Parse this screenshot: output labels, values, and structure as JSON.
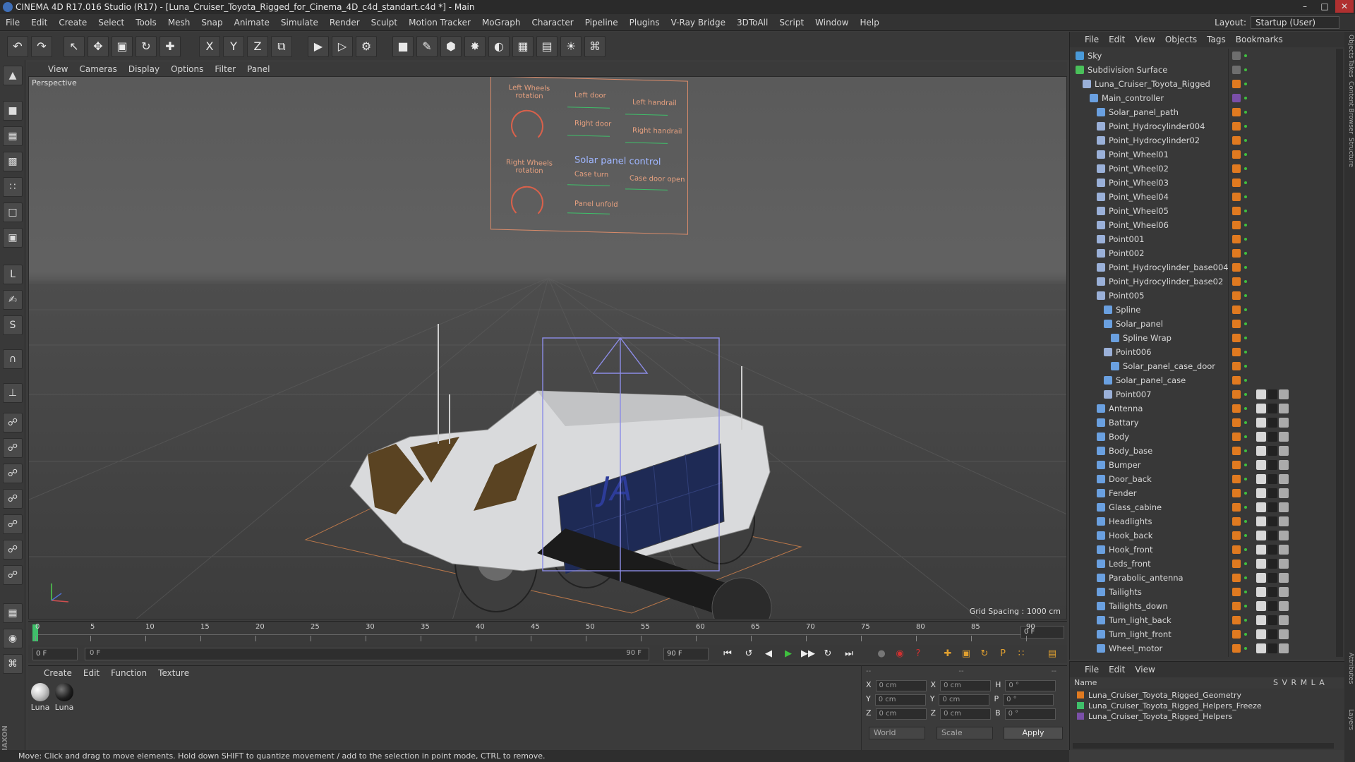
{
  "window": {
    "title": "CINEMA 4D R17.016 Studio (R17) - [Luna_Cruiser_Toyota_Rigged_for_Cinema_4D_c4d_standart.c4d *] - Main",
    "controls": [
      "–",
      "□",
      "✕"
    ]
  },
  "menubar": {
    "items": [
      "File",
      "Edit",
      "Create",
      "Select",
      "Tools",
      "Mesh",
      "Snap",
      "Animate",
      "Simulate",
      "Render",
      "Sculpt",
      "Motion Tracker",
      "MoGraph",
      "Character",
      "Pipeline",
      "Plugins",
      "V-Ray Bridge",
      "3DToAll",
      "Script",
      "Window",
      "Help"
    ],
    "layout_label": "Layout:",
    "layout_value": "Startup (User)"
  },
  "toolbar": {
    "buttons": [
      {
        "name": "undo",
        "glyph": "↶"
      },
      {
        "name": "redo",
        "glyph": "↷"
      },
      {
        "name": "live-selection",
        "glyph": "↖"
      },
      {
        "name": "move",
        "glyph": "✥"
      },
      {
        "name": "scale",
        "glyph": "▣"
      },
      {
        "name": "rotate",
        "glyph": "↻"
      },
      {
        "name": "last-tool",
        "glyph": "✚"
      },
      {
        "name": "x-axis",
        "glyph": "X"
      },
      {
        "name": "y-axis",
        "glyph": "Y"
      },
      {
        "name": "z-axis",
        "glyph": "Z"
      },
      {
        "name": "coordinate-system",
        "glyph": "⧉"
      },
      {
        "name": "render-view",
        "glyph": "▶"
      },
      {
        "name": "render-picture-viewer",
        "glyph": "▷"
      },
      {
        "name": "edit-render-settings",
        "glyph": "⚙"
      },
      {
        "name": "cube",
        "glyph": "■"
      },
      {
        "name": "spline-pen",
        "glyph": "✎"
      },
      {
        "name": "subdivision-surface",
        "glyph": "⬢"
      },
      {
        "name": "array",
        "glyph": "✸"
      },
      {
        "name": "deformer",
        "glyph": "◐"
      },
      {
        "name": "floor",
        "glyph": "▦"
      },
      {
        "name": "camera",
        "glyph": "▤"
      },
      {
        "name": "light",
        "glyph": "☀"
      },
      {
        "name": "python",
        "glyph": "⌘"
      }
    ]
  },
  "viewport": {
    "menu": [
      "View",
      "Cameras",
      "Display",
      "Options",
      "Filter",
      "Panel"
    ],
    "label": "Perspective",
    "grid_spacing": "Grid Spacing : 1000 cm",
    "control_board": {
      "left_wheels": "Left Wheels rotation",
      "right_wheels": "Right Wheels rotation",
      "left_door": "Left door",
      "right_door": "Right door",
      "left_handrail": "Left handrail",
      "right_handrail": "Right handrail",
      "solar_title": "Solar panel control",
      "case_turn": "Case turn",
      "case_door": "Case door open",
      "panel_unfold": "Panel unfold"
    }
  },
  "timeline": {
    "ticks": [
      "0",
      "5",
      "10",
      "15",
      "20",
      "25",
      "30",
      "35",
      "40",
      "45",
      "50",
      "55",
      "60",
      "65",
      "70",
      "75",
      "80",
      "85",
      "90"
    ],
    "frame_field": "0 F"
  },
  "transport": {
    "start_field": "0 F",
    "range_left": "0 F",
    "range_right": "90 F",
    "end_field": "90 F",
    "buttons": [
      "⏮",
      "↺",
      "◀",
      "▶",
      "▶▶",
      "↻",
      "⏭"
    ]
  },
  "material_panel": {
    "menu": [
      "Create",
      "Edit",
      "Function",
      "Texture"
    ],
    "materials": [
      {
        "label": "Luna",
        "color": "#c8c8c8"
      },
      {
        "label": "Luna",
        "color": "#1e1e1e"
      }
    ]
  },
  "coord_panel": {
    "header": [
      "--",
      "--",
      "--"
    ],
    "rows": [
      {
        "a": "X",
        "av": "0 cm",
        "b": "X",
        "bv": "0 cm",
        "c": "H",
        "cv": "0 °"
      },
      {
        "a": "Y",
        "av": "0 cm",
        "b": "Y",
        "bv": "0 cm",
        "c": "P",
        "cv": "0 °"
      },
      {
        "a": "Z",
        "av": "0 cm",
        "b": "Z",
        "bv": "0 cm",
        "c": "B",
        "cv": "0 °"
      }
    ],
    "world": "World",
    "scale": "Scale",
    "apply": "Apply"
  },
  "status": "Move: Click and drag to move elements. Hold down SHIFT to quantize movement / add to the selection in point mode, CTRL to remove.",
  "object_manager": {
    "menu": [
      "File",
      "Edit",
      "View",
      "Objects",
      "Tags",
      "Bookmarks"
    ],
    "objects": [
      {
        "name": "Sky",
        "depth": 0,
        "icon": "#4a9ad9",
        "sw": "#6e6e6e"
      },
      {
        "name": "Subdivision Surface",
        "depth": 0,
        "icon": "#4ac05a",
        "sw": "#6e6e6e"
      },
      {
        "name": "Luna_Cruiser_Toyota_Rigged",
        "depth": 1,
        "icon": "#9ab0d8",
        "sw": "#e07a20"
      },
      {
        "name": "Main_controller",
        "depth": 2,
        "icon": "#6aa0e0",
        "sw": "#7a4fa8"
      },
      {
        "name": "Solar_panel_path",
        "depth": 3,
        "icon": "#6aa0e0",
        "sw": "#e07a20"
      },
      {
        "name": "Point_Hydrocylinder004",
        "depth": 3,
        "icon": "#9ab0d8",
        "sw": "#e07a20"
      },
      {
        "name": "Point_Hydrocylinder02",
        "depth": 3,
        "icon": "#9ab0d8",
        "sw": "#e07a20"
      },
      {
        "name": "Point_Wheel01",
        "depth": 3,
        "icon": "#9ab0d8",
        "sw": "#e07a20"
      },
      {
        "name": "Point_Wheel02",
        "depth": 3,
        "icon": "#9ab0d8",
        "sw": "#e07a20"
      },
      {
        "name": "Point_Wheel03",
        "depth": 3,
        "icon": "#9ab0d8",
        "sw": "#e07a20"
      },
      {
        "name": "Point_Wheel04",
        "depth": 3,
        "icon": "#9ab0d8",
        "sw": "#e07a20"
      },
      {
        "name": "Point_Wheel05",
        "depth": 3,
        "icon": "#9ab0d8",
        "sw": "#e07a20"
      },
      {
        "name": "Point_Wheel06",
        "depth": 3,
        "icon": "#9ab0d8",
        "sw": "#e07a20"
      },
      {
        "name": "Point001",
        "depth": 3,
        "icon": "#9ab0d8",
        "sw": "#e07a20"
      },
      {
        "name": "Point002",
        "depth": 3,
        "icon": "#9ab0d8",
        "sw": "#e07a20"
      },
      {
        "name": "Point_Hydrocylinder_base004",
        "depth": 3,
        "icon": "#9ab0d8",
        "sw": "#e07a20"
      },
      {
        "name": "Point_Hydrocylinder_base02",
        "depth": 3,
        "icon": "#9ab0d8",
        "sw": "#e07a20"
      },
      {
        "name": "Point005",
        "depth": 3,
        "icon": "#9ab0d8",
        "sw": "#e07a20"
      },
      {
        "name": "Spline",
        "depth": 4,
        "icon": "#6aa0e0",
        "sw": "#e07a20"
      },
      {
        "name": "Solar_panel",
        "depth": 4,
        "icon": "#6aa0e0",
        "sw": "#e07a20"
      },
      {
        "name": "Spline Wrap",
        "depth": 5,
        "icon": "#6aa0e0",
        "sw": "#e07a20"
      },
      {
        "name": "Point006",
        "depth": 4,
        "icon": "#9ab0d8",
        "sw": "#e07a20"
      },
      {
        "name": "Solar_panel_case_door",
        "depth": 5,
        "icon": "#6aa0e0",
        "sw": "#e07a20"
      },
      {
        "name": "Solar_panel_case",
        "depth": 4,
        "icon": "#6aa0e0",
        "sw": "#e07a20"
      },
      {
        "name": "Point007",
        "depth": 4,
        "icon": "#9ab0d8",
        "sw": "#e07a20"
      },
      {
        "name": "Antenna",
        "depth": 3,
        "icon": "#6aa0e0",
        "sw": "#e07a20"
      },
      {
        "name": "Battary",
        "depth": 3,
        "icon": "#6aa0e0",
        "sw": "#e07a20"
      },
      {
        "name": "Body",
        "depth": 3,
        "icon": "#6aa0e0",
        "sw": "#e07a20"
      },
      {
        "name": "Body_base",
        "depth": 3,
        "icon": "#6aa0e0",
        "sw": "#e07a20"
      },
      {
        "name": "Bumper",
        "depth": 3,
        "icon": "#6aa0e0",
        "sw": "#e07a20"
      },
      {
        "name": "Door_back",
        "depth": 3,
        "icon": "#6aa0e0",
        "sw": "#e07a20"
      },
      {
        "name": "Fender",
        "depth": 3,
        "icon": "#6aa0e0",
        "sw": "#e07a20"
      },
      {
        "name": "Glass_cabine",
        "depth": 3,
        "icon": "#6aa0e0",
        "sw": "#e07a20"
      },
      {
        "name": "Headlights",
        "depth": 3,
        "icon": "#6aa0e0",
        "sw": "#e07a20"
      },
      {
        "name": "Hook_back",
        "depth": 3,
        "icon": "#6aa0e0",
        "sw": "#e07a20"
      },
      {
        "name": "Hook_front",
        "depth": 3,
        "icon": "#6aa0e0",
        "sw": "#e07a20"
      },
      {
        "name": "Leds_front",
        "depth": 3,
        "icon": "#6aa0e0",
        "sw": "#e07a20"
      },
      {
        "name": "Parabolic_antenna",
        "depth": 3,
        "icon": "#6aa0e0",
        "sw": "#e07a20"
      },
      {
        "name": "Tailights",
        "depth": 3,
        "icon": "#6aa0e0",
        "sw": "#e07a20"
      },
      {
        "name": "Tailights_down",
        "depth": 3,
        "icon": "#6aa0e0",
        "sw": "#e07a20"
      },
      {
        "name": "Turn_light_back",
        "depth": 3,
        "icon": "#6aa0e0",
        "sw": "#e07a20"
      },
      {
        "name": "Turn_light_front",
        "depth": 3,
        "icon": "#6aa0e0",
        "sw": "#e07a20"
      },
      {
        "name": "Wheel_motor",
        "depth": 3,
        "icon": "#6aa0e0",
        "sw": "#e07a20"
      }
    ]
  },
  "layer_manager": {
    "menu": [
      "File",
      "Edit",
      "View"
    ],
    "column_name": "Name",
    "column_flags": "S V R M L A",
    "layers": [
      {
        "name": "Luna_Cruiser_Toyota_Rigged_Geometry",
        "color": "#e07a20"
      },
      {
        "name": "Luna_Cruiser_Toyota_Rigged_Helpers_Freeze",
        "color": "#3fbf6a"
      },
      {
        "name": "Luna_Cruiser_Toyota_Rigged_Helpers",
        "color": "#7a4fa8"
      }
    ]
  },
  "side_tabs": [
    "Objects",
    "Takes",
    "Content Browser",
    "Structure",
    "Attributes",
    "Layers"
  ]
}
